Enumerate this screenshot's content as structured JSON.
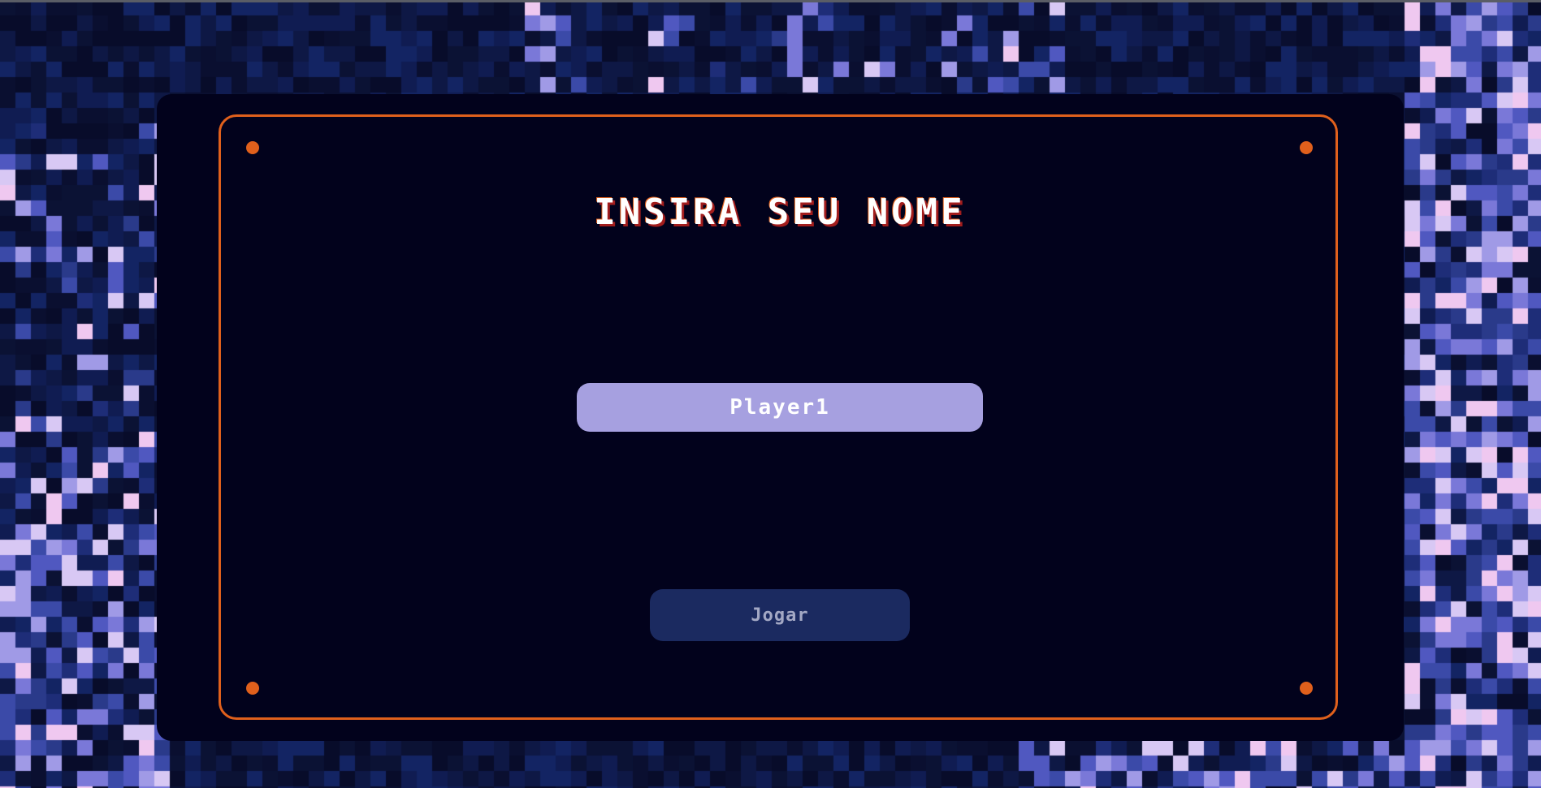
{
  "screen": {
    "title": "INSIRA SEU NOME"
  },
  "name_field": {
    "value": "Player1"
  },
  "play_button": {
    "label": "Jogar"
  },
  "colors": {
    "background": "#0a0f2e",
    "panel": "#02021c",
    "frame_accent": "#e0601c",
    "input_bg": "#a6a0e0",
    "button_bg": "#1b2a60",
    "button_text": "#a3a8c4",
    "title_text": "#ffffff",
    "title_shadow": "#a21d1d"
  }
}
